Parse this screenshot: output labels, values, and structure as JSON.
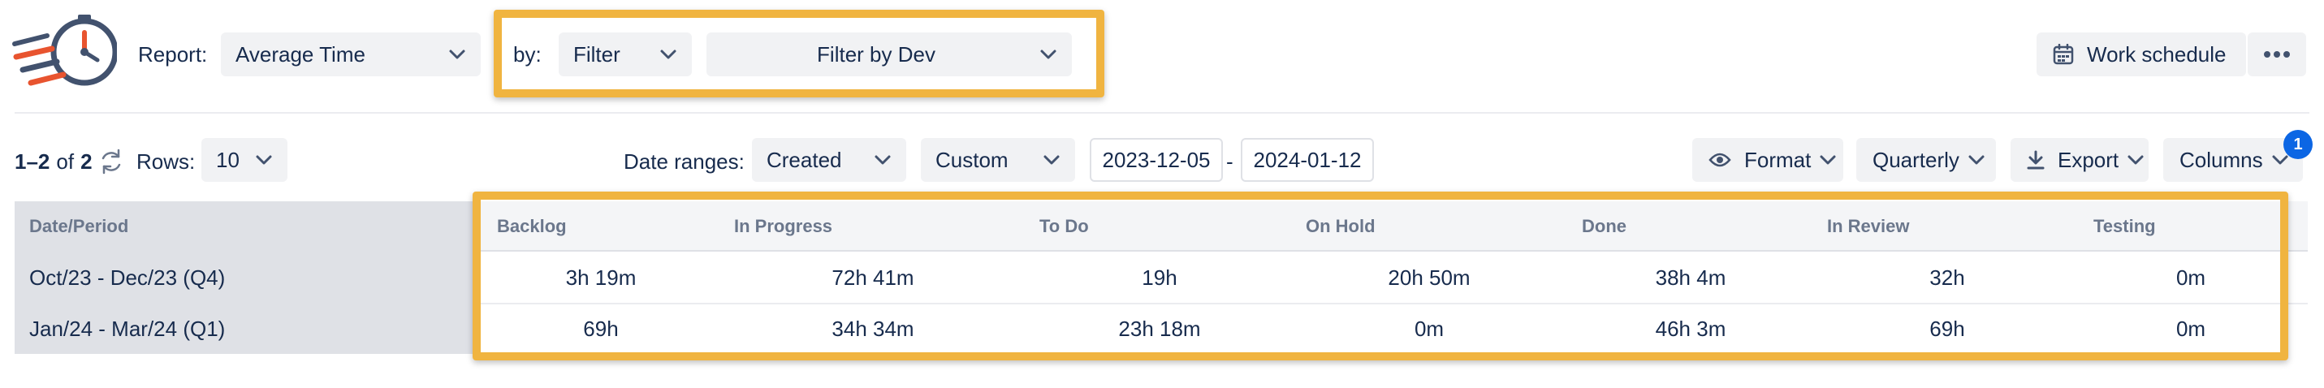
{
  "header": {
    "report_label": "Report:",
    "report_value": "Average Time",
    "by_label": "by:",
    "by_value": "Filter",
    "filter_value": "Filter by Dev",
    "work_schedule_label": "Work schedule",
    "more_icon": "more-horizontal-icon"
  },
  "toolbar": {
    "pagination_range": "1–2",
    "pagination_of": "of",
    "pagination_total": "2",
    "rows_label": "Rows:",
    "rows_value": "10",
    "date_ranges_label": "Date ranges:",
    "date_field_value": "Created",
    "date_mode_value": "Custom",
    "date_from": "2023-12-05",
    "date_separator": "-",
    "date_to": "2024-01-12",
    "format_label": "Format",
    "period_value": "Quarterly",
    "export_label": "Export",
    "columns_label": "Columns",
    "columns_badge": "1"
  },
  "table": {
    "columns": [
      "Date/Period",
      "Backlog",
      "In Progress",
      "To Do",
      "On Hold",
      "Done",
      "In Review",
      "Testing"
    ],
    "rows": [
      {
        "period": "Oct/23 - Dec/23 (Q4)",
        "values": [
          "3h 19m",
          "72h 41m",
          "19h",
          "20h 50m",
          "38h 4m",
          "32h",
          "0m"
        ]
      },
      {
        "period": "Jan/24 - Mar/24 (Q1)",
        "values": [
          "69h",
          "34h 34m",
          "23h 18m",
          "0m",
          "46h 3m",
          "69h",
          "0m"
        ]
      }
    ]
  },
  "colors": {
    "highlight": "#f0b440",
    "control_bg": "#f1f2f4",
    "badge": "#0c66e4",
    "logo_accent": "#e8542f",
    "logo_dark": "#42526e"
  }
}
